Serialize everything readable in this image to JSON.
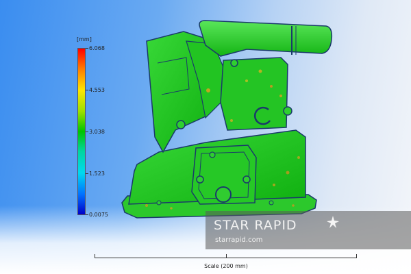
{
  "legend": {
    "unit": "[mm]",
    "ticks": [
      "6.068",
      "4.553",
      "3.038",
      "1.523",
      "0.0075"
    ]
  },
  "watermark": {
    "title": "STAR RAPID",
    "url": "starrapid.com"
  },
  "scale": {
    "label": "Scale (200 mm)"
  },
  "colors": {
    "part_green": "#1ec81e",
    "outline": "#1a3a6a",
    "background_left": "#3a8df0",
    "background_right": "#f4f6fa"
  },
  "icons": {
    "star": "star-icon"
  }
}
